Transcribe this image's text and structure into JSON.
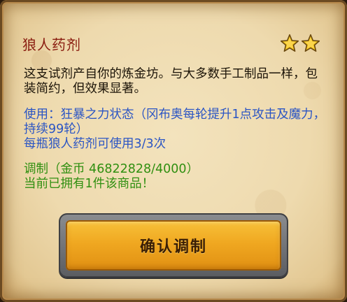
{
  "item": {
    "name": "狼人药剂",
    "rating_stars": 2,
    "star_color": "#f5c518"
  },
  "description": "这支试剂产自你的炼金坊。与大多数手工制品一样，包装简约，但效果显著。",
  "usage": {
    "effect_line": "使用：狂暴之力状态（冈布奥每轮提升1点攻击及魔力，持续99轮）",
    "uses_line": "每瓶狼人药剂可使用3/3次"
  },
  "crafting": {
    "cost_line": "调制（金币 46822828/4000）",
    "owned_line": "当前已拥有1件该商品！"
  },
  "confirm_button": {
    "label": "确认调制"
  },
  "colors": {
    "title": "#8a1d10",
    "usage_text": "#2b55c4",
    "craft_text": "#2f8f10",
    "button_gold": "#f0a821"
  }
}
